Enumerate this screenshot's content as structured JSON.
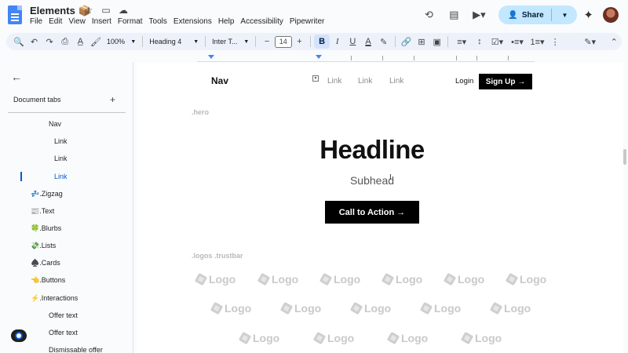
{
  "doc": {
    "title": "Elements",
    "title_emoji": "📦",
    "menu": [
      "File",
      "Edit",
      "View",
      "Insert",
      "Format",
      "Tools",
      "Extensions",
      "Help",
      "Accessibility",
      "Pipewriter"
    ],
    "share_label": "Share"
  },
  "toolbar": {
    "zoom": "100%",
    "style": "Heading 4",
    "font": "Inter T...",
    "font_size": "14",
    "minus": "−",
    "plus": "+",
    "bold": "B",
    "italic": "I",
    "underline": "U",
    "text_color": "A"
  },
  "sidebar": {
    "heading": "Document tabs",
    "items": [
      {
        "label": "Nav",
        "indent": 2
      },
      {
        "label": "Link",
        "indent": 3
      },
      {
        "label": "Link",
        "indent": 3
      },
      {
        "label": "Link",
        "indent": 3,
        "active": true
      },
      {
        "label": "💤.Zigzag",
        "indent": 1
      },
      {
        "label": "📰.Text",
        "indent": 1
      },
      {
        "label": "🍀.Blurbs",
        "indent": 1
      },
      {
        "label": "💸.Lists",
        "indent": 1
      },
      {
        "label": "♠️.Cards",
        "indent": 1
      },
      {
        "label": "👈.Buttons",
        "indent": 1
      },
      {
        "label": "⚡.Interactions",
        "indent": 1
      },
      {
        "label": "Offer text",
        "indent": 2
      },
      {
        "label": "Offer text",
        "indent": 2
      },
      {
        "label": "Dismissable offer",
        "indent": 2
      }
    ]
  },
  "page": {
    "nav_logo": "Nav",
    "nav_links": [
      "Link",
      "Link",
      "Link"
    ],
    "login": "Login",
    "signup": "Sign Up →",
    "hero_tag": ".hero",
    "headline": "Headline",
    "subhead": "Subhead",
    "cta": "Call to Action →",
    "logos_tag": ".logos .trustbar",
    "logo_text": "Logo"
  }
}
